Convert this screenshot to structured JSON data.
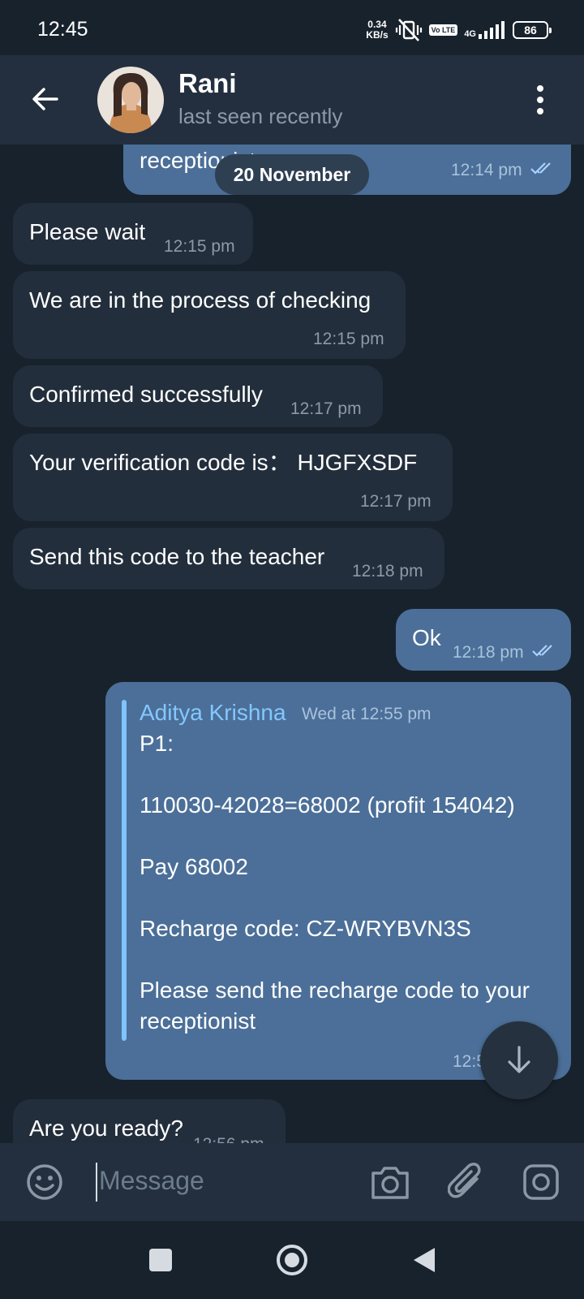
{
  "status_bar": {
    "time": "12:45",
    "speed_value": "0.34",
    "speed_unit": "KB/s",
    "volte_label": "Vo LTE",
    "network": "4G",
    "battery": "86"
  },
  "header": {
    "name": "Rani",
    "status": "last seen recently"
  },
  "chat": {
    "date_pill": "20 November",
    "messages": [
      {
        "type": "outgoing",
        "text": "receptionist",
        "time": "12:14 pm",
        "read": true
      },
      {
        "type": "incoming",
        "text": "Please wait",
        "time": "12:15 pm"
      },
      {
        "type": "incoming",
        "text": "We are in the process of checking",
        "time": "12:15 pm"
      },
      {
        "type": "incoming",
        "text": "Confirmed successfully",
        "time": "12:17 pm"
      },
      {
        "type": "incoming",
        "text": "Your verification code is： HJGFXSDF",
        "time": "12:17 pm"
      },
      {
        "type": "incoming",
        "text": "Send this code to the teacher",
        "time": "12:18 pm"
      },
      {
        "type": "outgoing",
        "text": "Ok",
        "time": "12:18 pm",
        "read": true
      },
      {
        "type": "outgoing_forwarded",
        "forwarded_from": "Aditya Krishna",
        "forwarded_date": "Wed at 12:55 pm",
        "lines": [
          "P1:",
          "110030-42028=68002 (profit 154042)",
          "Pay 68002",
          "Recharge code: CZ-WRYBVN3S",
          "Please send the recharge code to your",
          "receptionist"
        ],
        "time_partial": "12:5"
      },
      {
        "type": "incoming",
        "text": "Are you ready?",
        "time_partial": "12:56 pm"
      }
    ]
  },
  "composer": {
    "placeholder": "Message"
  },
  "colors": {
    "background": "#18222d",
    "header": "#232f3e",
    "incoming_bubble": "#232e3c",
    "outgoing_bubble": "#4b6f98",
    "accent": "#84c7ff"
  },
  "icons": [
    "back-arrow-icon",
    "more-vert-icon",
    "emoji-icon",
    "camera-icon",
    "attach-icon",
    "instagram-icon",
    "scroll-down-icon",
    "read-ticks-icon"
  ]
}
